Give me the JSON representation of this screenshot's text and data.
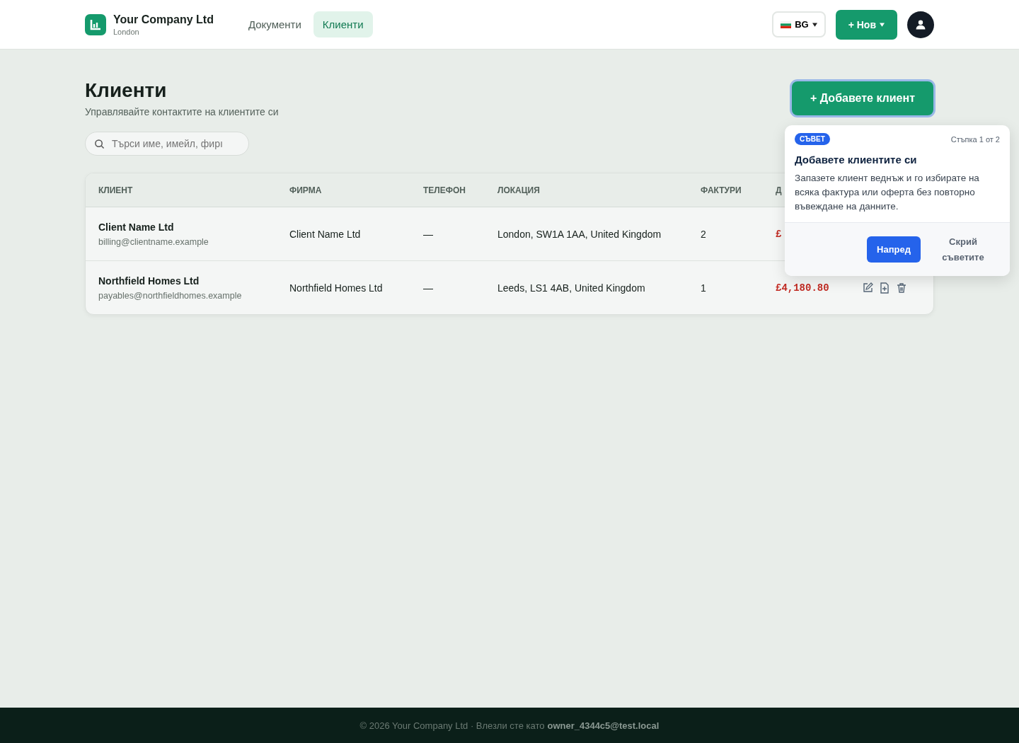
{
  "header": {
    "company": "Your Company Ltd",
    "city": "London",
    "nav": [
      {
        "label": "Документи",
        "selected": false
      },
      {
        "label": "Клиенти",
        "selected": true
      }
    ],
    "language": "BG",
    "new_button": "+ Нов"
  },
  "page": {
    "title": "Клиенти",
    "subtitle": "Управлявайте контактите на клиентите си",
    "add_button": "+ Добавете клиент",
    "search": {
      "placeholder": "Търси име, имейл, фирı"
    }
  },
  "table": {
    "columns": [
      "КЛИЕНТ",
      "ФИРМА",
      "ТЕЛЕФОН",
      "ЛОКАЦИЯ",
      "ФАКТУРИ",
      "Д"
    ],
    "rows": [
      {
        "name": "Client Name Ltd",
        "email": "billing@clientname.example",
        "company": "Client Name Ltd",
        "phone": "—",
        "location": "London, SW1A 1AA, United Kingdom",
        "invoices": "2",
        "amount": "£"
      },
      {
        "name": "Northfield Homes Ltd",
        "email": "payables@northfieldhomes.example",
        "company": "Northfield Homes Ltd",
        "phone": "—",
        "location": "Leeds, LS1 4AB, United Kingdom",
        "invoices": "1",
        "amount": "£4,180.80",
        "actions": [
          {
            "kind": "edit"
          },
          {
            "kind": "add"
          },
          {
            "kind": "delete"
          }
        ]
      }
    ]
  },
  "tip": {
    "badge": "СЪВЕТ",
    "step": "Стъпка 1 от 2",
    "title": "Добавете клиентите си",
    "body": "Запазете клиент веднъж и го избирате на всяка фактура или оферта без повторно въвеждане на данните.",
    "next_button": "Напред",
    "hide_button": "Скрий съветите"
  },
  "footer": {
    "text": "© 2026 Your Company Ltd · Влезли сте като",
    "user": "owner_4344c5@test.local"
  }
}
